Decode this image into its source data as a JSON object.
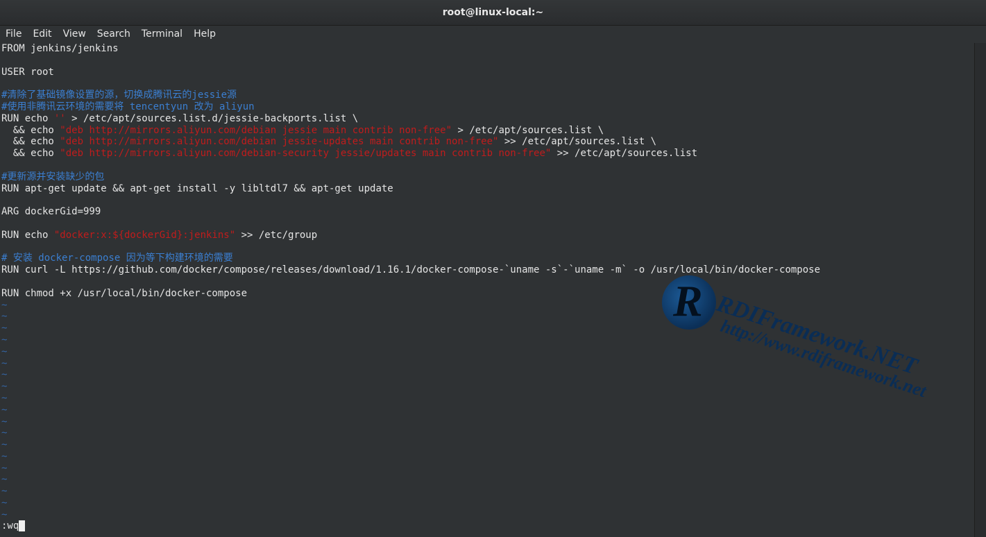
{
  "window": {
    "title": "root@linux-local:~"
  },
  "menu": {
    "items": [
      "File",
      "Edit",
      "View",
      "Search",
      "Terminal",
      "Help"
    ]
  },
  "editor": {
    "lines": [
      [
        {
          "t": "FROM jenkins/jenkins",
          "c": "plain"
        }
      ],
      [
        {
          "t": "",
          "c": "plain"
        }
      ],
      [
        {
          "t": "USER root",
          "c": "plain"
        }
      ],
      [
        {
          "t": "",
          "c": "plain"
        }
      ],
      [
        {
          "t": "#清除了基础镜像设置的源，切换成腾讯云的jessie源",
          "c": "comment"
        }
      ],
      [
        {
          "t": "#使用非腾讯云环境的需要将 tencentyun 改为 aliyun",
          "c": "comment"
        }
      ],
      [
        {
          "t": "RUN echo ",
          "c": "plain"
        },
        {
          "t": "''",
          "c": "string"
        },
        {
          "t": " > /etc/apt/sources.list.d/jessie-backports.list \\",
          "c": "plain"
        }
      ],
      [
        {
          "t": "  && echo ",
          "c": "plain"
        },
        {
          "t": "\"deb http://mirrors.aliyun.com/debian jessie main contrib non-free\"",
          "c": "string"
        },
        {
          "t": " > /etc/apt/sources.list \\",
          "c": "plain"
        }
      ],
      [
        {
          "t": "  && echo ",
          "c": "plain"
        },
        {
          "t": "\"deb http://mirrors.aliyun.com/debian jessie-updates main contrib non-free\"",
          "c": "string"
        },
        {
          "t": " >> /etc/apt/sources.list \\",
          "c": "plain"
        }
      ],
      [
        {
          "t": "  && echo ",
          "c": "plain"
        },
        {
          "t": "\"deb http://mirrors.aliyun.com/debian-security jessie/updates main contrib non-free\"",
          "c": "string"
        },
        {
          "t": " >> /etc/apt/sources.list",
          "c": "plain"
        }
      ],
      [
        {
          "t": "",
          "c": "plain"
        }
      ],
      [
        {
          "t": "#更新源并安装缺少的包",
          "c": "comment"
        }
      ],
      [
        {
          "t": "RUN apt-get update && apt-get install -y libltdl7 && apt-get update",
          "c": "plain"
        }
      ],
      [
        {
          "t": "",
          "c": "plain"
        }
      ],
      [
        {
          "t": "ARG dockerGid=999",
          "c": "plain"
        }
      ],
      [
        {
          "t": "",
          "c": "plain"
        }
      ],
      [
        {
          "t": "RUN echo ",
          "c": "plain"
        },
        {
          "t": "\"docker:x:${dockerGid}:jenkins\"",
          "c": "string"
        },
        {
          "t": " >> /etc/group",
          "c": "plain"
        }
      ],
      [
        {
          "t": "",
          "c": "plain"
        }
      ],
      [
        {
          "t": "# 安装 docker-compose 因为等下构建环境的需要",
          "c": "comment"
        }
      ],
      [
        {
          "t": "RUN curl -L https://github.com/docker/compose/releases/download/1.16.1/docker-compose-`uname -s`-`uname -m` -o /usr/local/bin/docker-compose",
          "c": "plain"
        }
      ],
      [
        {
          "t": "",
          "c": "plain"
        }
      ],
      [
        {
          "t": "RUN chmod +x /usr/local/bin/docker-compose",
          "c": "plain"
        }
      ]
    ],
    "tilde_line": "~",
    "tilde_count": 19,
    "command": ":wq"
  },
  "watermark": {
    "logo_letter": "R",
    "name": "RDIFramework.NET",
    "url": "http://www.rdiframework.net"
  }
}
